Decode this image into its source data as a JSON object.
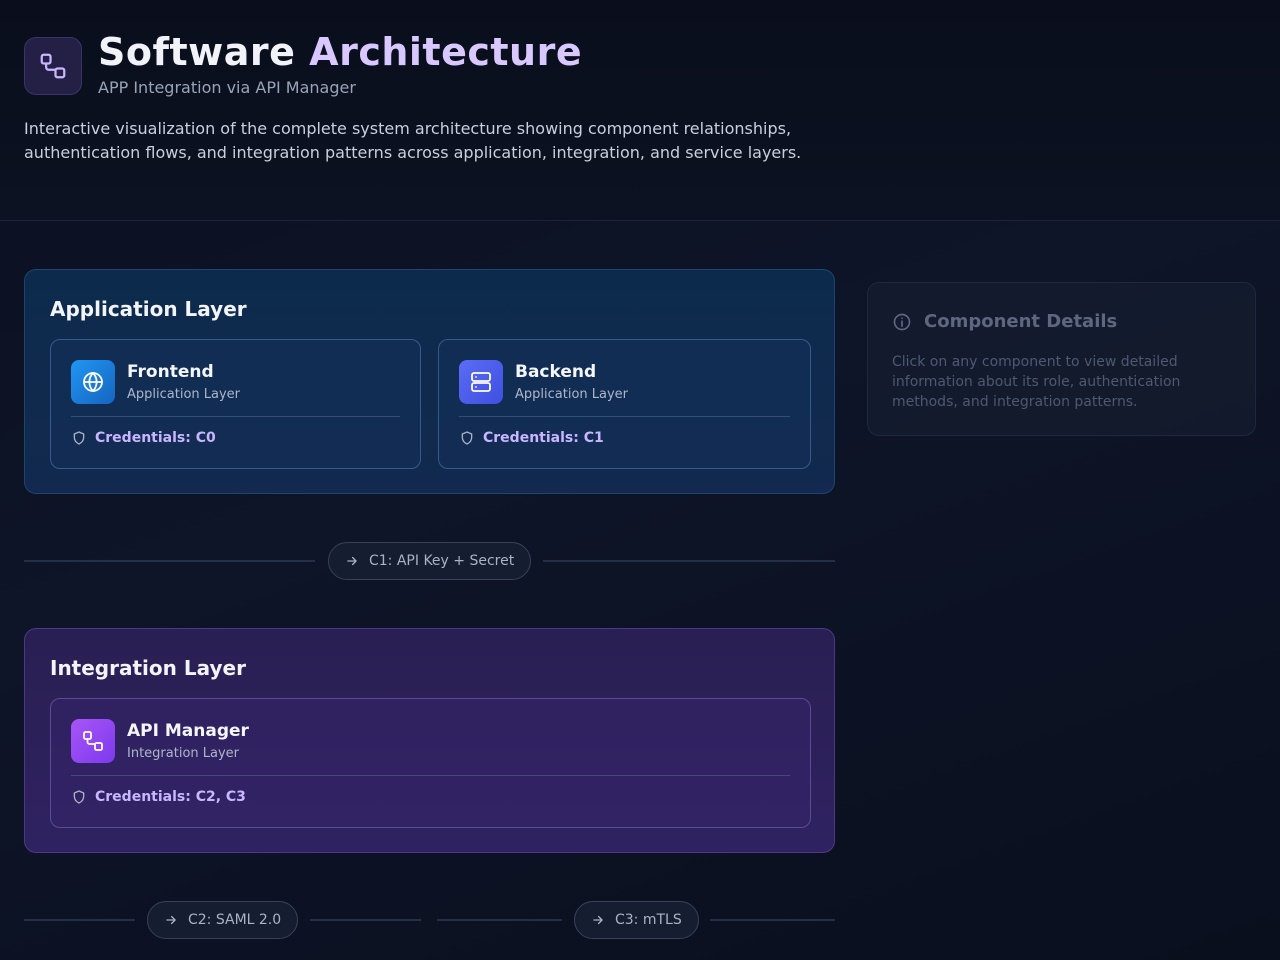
{
  "header": {
    "title_main": "Software",
    "title_accent": "Architecture",
    "subtitle": "APP Integration via API Manager",
    "description": "Interactive visualization of the complete system architecture showing component relationships, authentication flows, and integration patterns across application, integration, and service layers.",
    "logo_icon": "workflow-icon"
  },
  "layers": {
    "application": {
      "title": "Application Layer",
      "components": [
        {
          "name": "Frontend",
          "layer": "Application Layer",
          "credentials": "Credentials: C0",
          "icon": "globe-icon",
          "icon_color": "#1e88e5"
        },
        {
          "name": "Backend",
          "layer": "Application Layer",
          "credentials": "Credentials: C1",
          "icon": "server-icon",
          "icon_color": "#4f63f0"
        }
      ]
    },
    "integration": {
      "title": "Integration Layer",
      "components": [
        {
          "name": "API Manager",
          "layer": "Integration Layer",
          "credentials": "Credentials: C2, C3",
          "icon": "workflow-icon",
          "icon_color": "#9b4dea"
        }
      ]
    }
  },
  "connections": [
    {
      "label": "C1: API Key + Secret"
    },
    {
      "label": "C2: SAML 2.0"
    },
    {
      "label": "C3: mTLS"
    }
  ],
  "details": {
    "title": "Component Details",
    "text": "Click on any component to view detailed information about its role, authentication methods, and integration patterns."
  }
}
